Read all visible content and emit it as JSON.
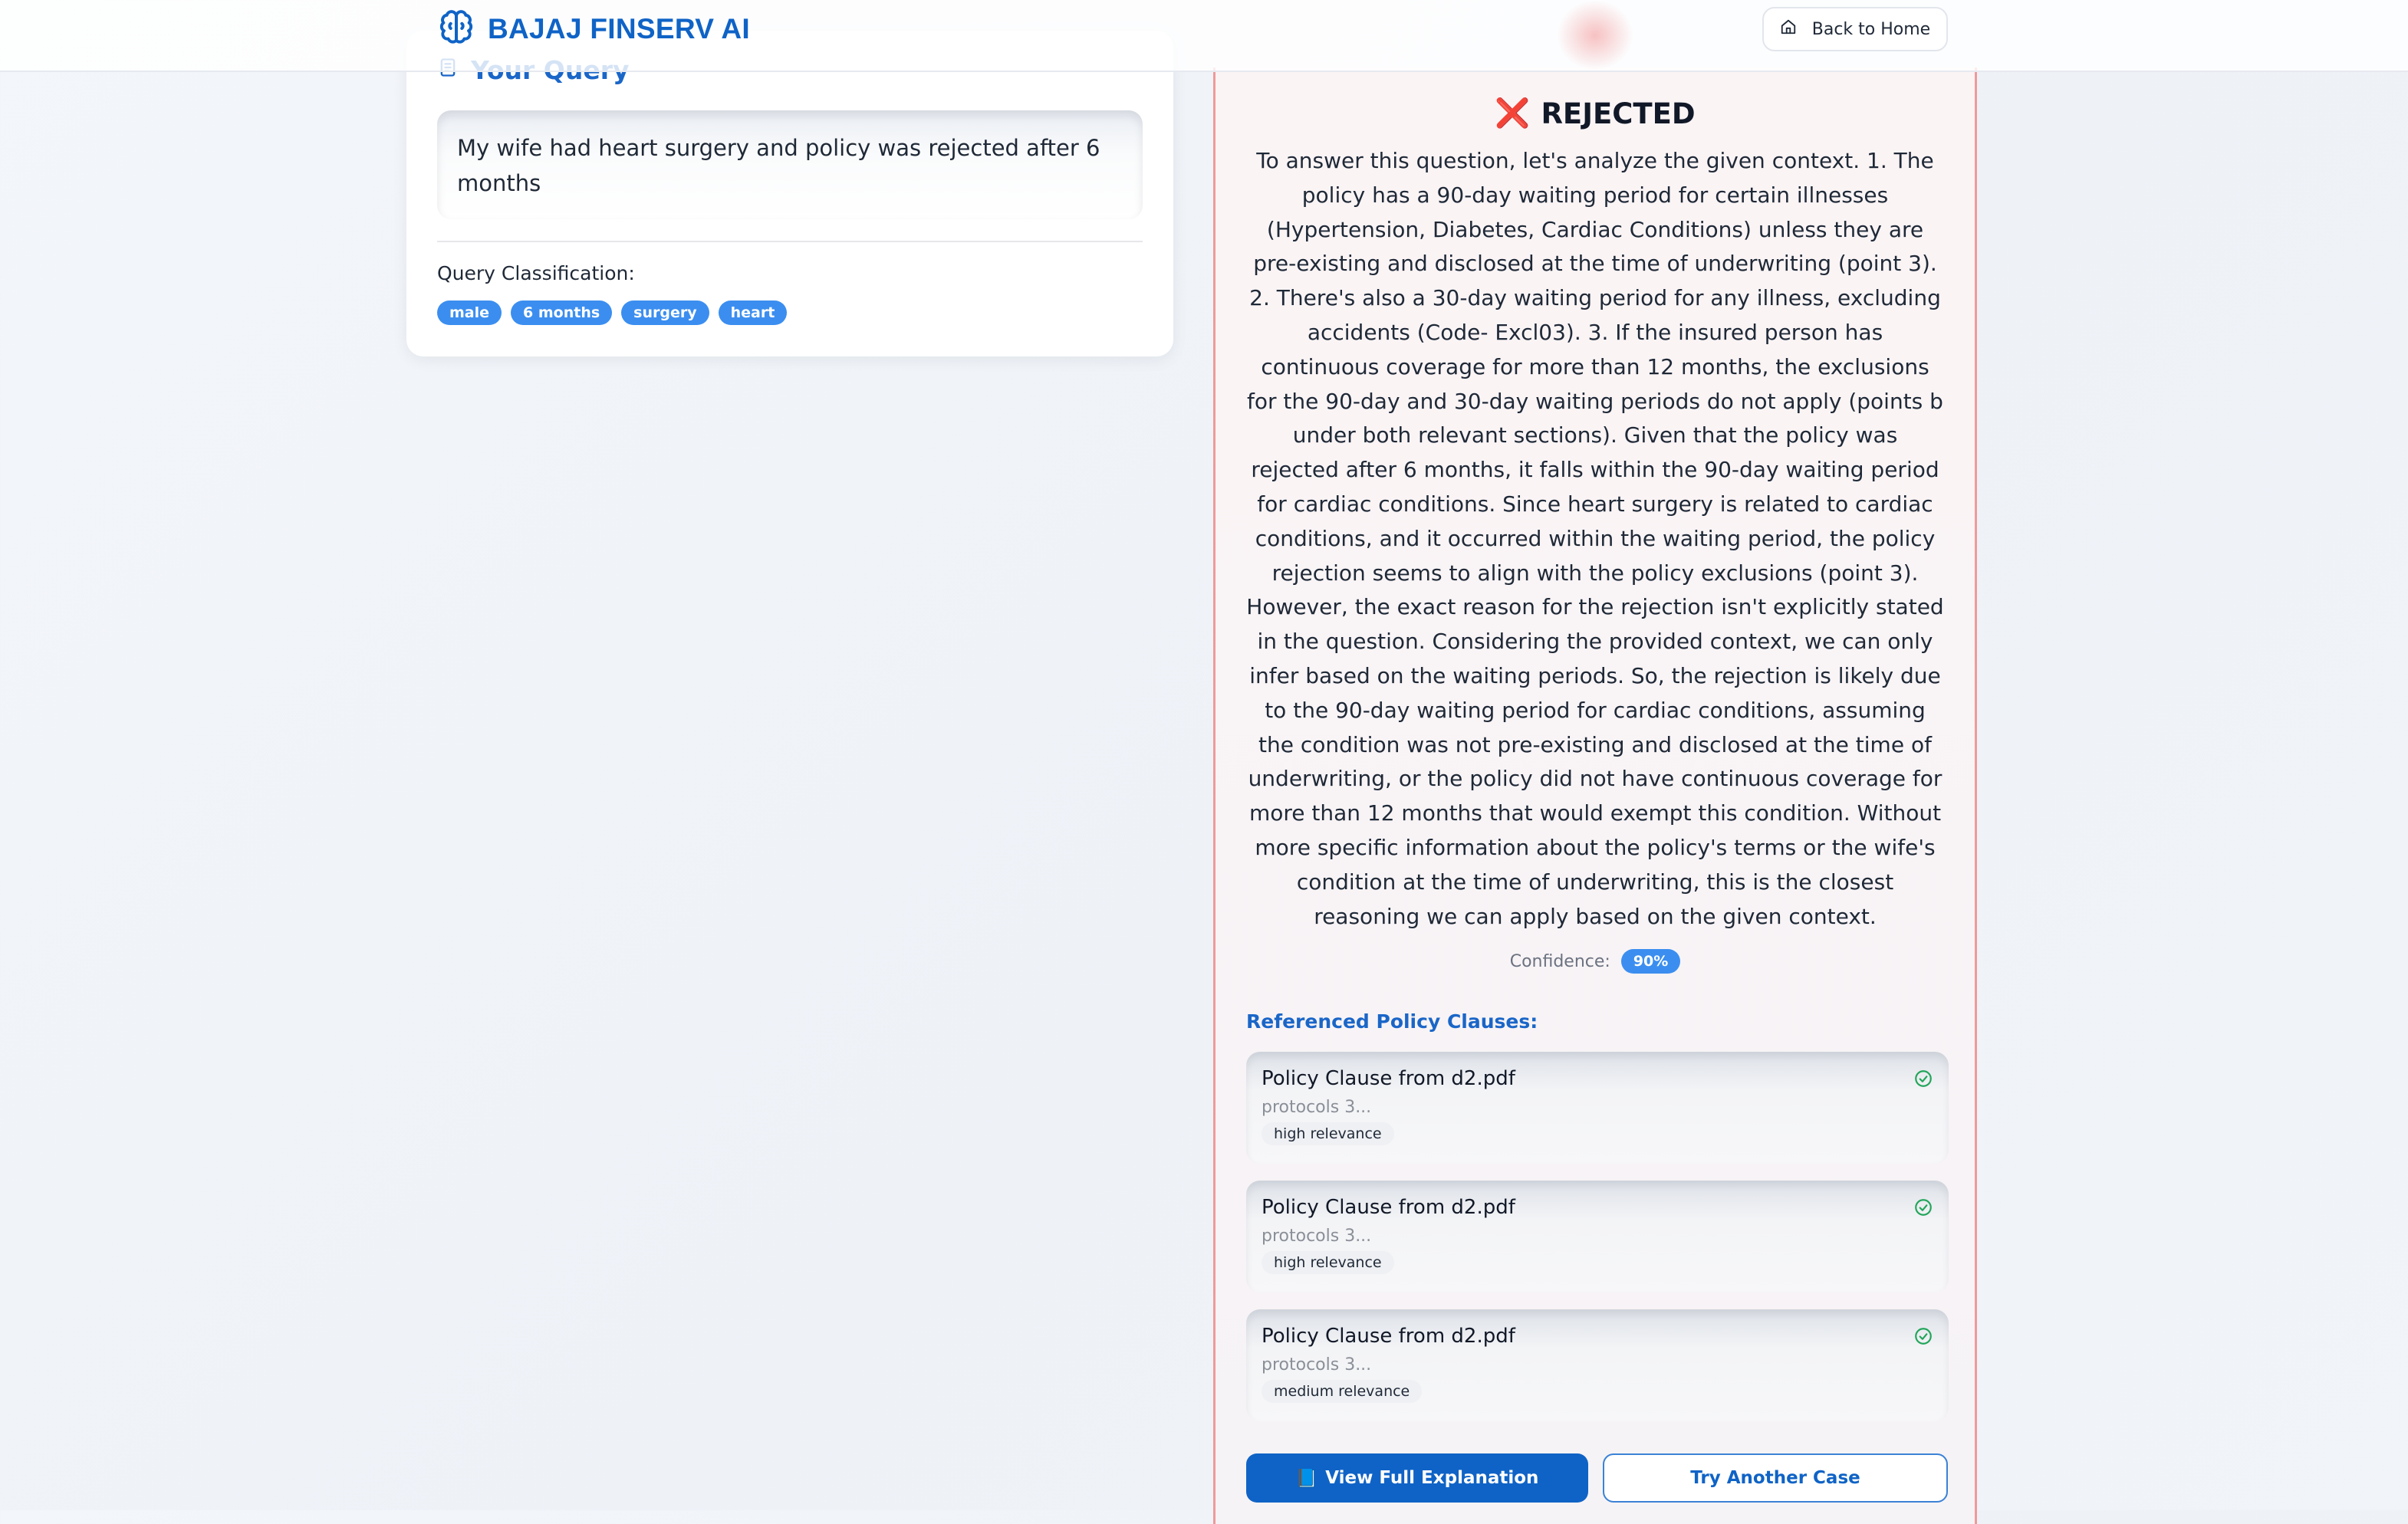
{
  "header": {
    "brand": "BAJAJ FINSERV AI",
    "back_label": "Back to Home"
  },
  "query": {
    "title": "Your Query",
    "text": "My wife had heart surgery and policy was rejected after 6 months",
    "classification_label": "Query Classification:",
    "tags": [
      "male",
      "6 months",
      "surgery",
      "heart"
    ]
  },
  "result": {
    "icon": "❌",
    "verdict": "REJECTED",
    "explanation": "To answer this question, let's analyze the given context. 1. The policy has a 90-day waiting period for certain illnesses (Hypertension, Diabetes, Cardiac Conditions) unless they are pre-existing and disclosed at the time of underwriting (point 3). 2. There's also a 30-day waiting period for any illness, excluding accidents (Code- Excl03). 3. If the insured person has continuous coverage for more than 12 months, the exclusions for the 90-day and 30-day waiting periods do not apply (points b under both relevant sections). Given that the policy was rejected after 6 months, it falls within the 90-day waiting period for cardiac conditions. Since heart surgery is related to cardiac conditions, and it occurred within the waiting period, the policy rejection seems to align with the policy exclusions (point 3). However, the exact reason for the rejection isn't explicitly stated in the question. Considering the provided context, we can only infer based on the waiting periods. So, the rejection is likely due to the 90-day waiting period for cardiac conditions, assuming the condition was not pre-existing and disclosed at the time of underwriting, or the policy did not have continuous coverage for more than 12 months that would exempt this condition. Without more specific information about the policy's terms or the wife's condition at the time of underwriting, this is the closest reasoning we can apply based on the given context.",
    "confidence_label": "Confidence:",
    "confidence_value": "90%",
    "references_title": "Referenced Policy Clauses:",
    "clauses": [
      {
        "title": "Policy Clause from d2.pdf",
        "snippet": "protocols 3...",
        "relevance": "high relevance"
      },
      {
        "title": "Policy Clause from d2.pdf",
        "snippet": "protocols 3...",
        "relevance": "high relevance"
      },
      {
        "title": "Policy Clause from d2.pdf",
        "snippet": "protocols 3...",
        "relevance": "medium relevance"
      }
    ],
    "primary_button": "View Full Explanation",
    "primary_button_icon": "📘",
    "secondary_button": "Try Another Case"
  },
  "icons": {
    "brand": "brain-icon",
    "home": "home-icon",
    "query": "document-icon",
    "verdict": "cross-mark-icon",
    "clause": "check-circle-icon",
    "book": "book-icon"
  },
  "colors": {
    "brand_blue": "#0f63c6",
    "tag_blue": "#3b8ef0",
    "reject_border": "#ef9a9a",
    "check_green": "#22a55a"
  }
}
